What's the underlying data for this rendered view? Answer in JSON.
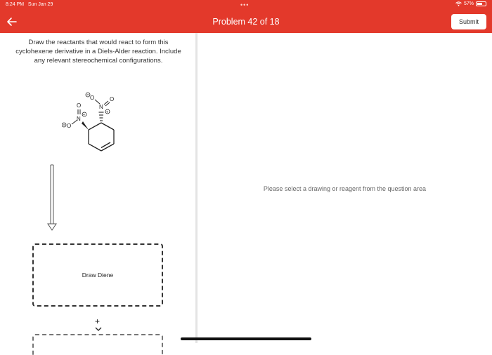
{
  "status_bar": {
    "time": "8:24 PM",
    "date": "Sun Jan 29",
    "battery": "57%",
    "icons": [
      "wifi-icon",
      "battery-icon"
    ]
  },
  "header": {
    "title": "Problem 42 of 18",
    "submit_label": "Submit",
    "back_icon": "back-arrow-icon",
    "background": "#e3392b"
  },
  "question": {
    "text": "Draw the reactants that would react to form this cyclohexene derivative in a Diels-Alder reaction. Include any relevant stereochemical configurations.",
    "molecule_labels": {
      "nitro1_o_minus": "O",
      "nitro1_n": "N",
      "nitro1_o": "O",
      "nitro2_o_minus": "O",
      "nitro2_n": "N",
      "nitro2_o": "O",
      "charge_plus": "+",
      "charge_minus": "−"
    }
  },
  "drop_zone": {
    "label": "Draw Diene",
    "add_symbol": "+"
  },
  "right_panel": {
    "message": "Please select a drawing or reagent from the question area"
  }
}
